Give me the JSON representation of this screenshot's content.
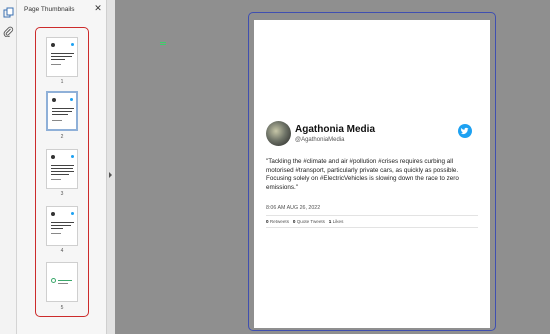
{
  "panel": {
    "title": "Page Thumbnails",
    "close_glyph": "✕"
  },
  "toolbar": {
    "icons": [
      "copy-pages-icon",
      "paperclip-icon"
    ]
  },
  "thumbnails": [
    {
      "number": "1",
      "selected": false
    },
    {
      "number": "2",
      "selected": true
    },
    {
      "number": "3",
      "selected": false
    },
    {
      "number": "4",
      "selected": false
    },
    {
      "number": "5",
      "selected": false
    }
  ],
  "tweet": {
    "author_name": "Agathonia Media",
    "handle": "@AgathoniaMedia",
    "text": "\"Tackling the #climate and air #pollution #crises requires curbing all motorised #transport, particularly private cars, as quickly as possible. Focusing solely on #ElectricVehicles is slowing down the race to zero emissions.\"",
    "time": "8:06 AM AUG 26, 2022",
    "retweets_count": "0",
    "retweets_label": "Retweets",
    "quotes_count": "0",
    "quotes_label": "Quote Tweets",
    "likes_count": "1",
    "likes_label": "Likes"
  },
  "colors": {
    "selection": "#cc2b2b",
    "page_frame": "#3f4fb0",
    "twitter": "#1da1f2",
    "viewer_bg": "#8f8f8f"
  }
}
